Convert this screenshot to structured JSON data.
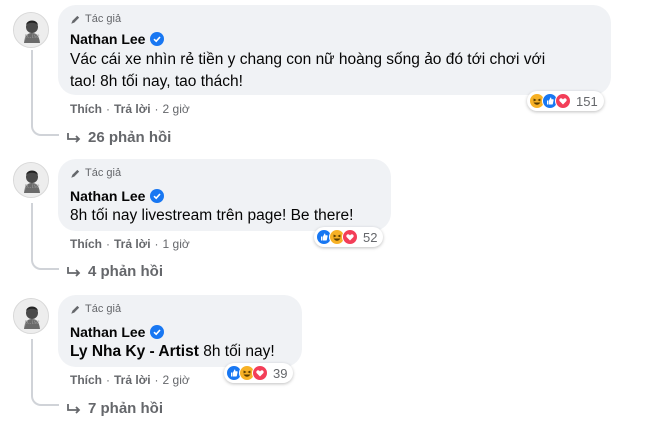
{
  "comments": [
    {
      "author_tag": "Tác giả",
      "name": "Nathan Lee",
      "lines": [
        "Vác cái xe nhìn rẻ tiền y chang con nữ hoàng sống ảo đó tới chơi với",
        "tao! 8h tối nay, tao thách!"
      ],
      "actions": {
        "like": "Thích",
        "reply": "Trả lời",
        "time": "2 giờ"
      },
      "reactions": {
        "icons": [
          "haha",
          "like",
          "love"
        ],
        "count": "151"
      },
      "replies": "26 phản hồi"
    },
    {
      "author_tag": "Tác giả",
      "name": "Nathan Lee",
      "lines": [
        "8h tối nay livestream trên page! Be there!"
      ],
      "actions": {
        "like": "Thích",
        "reply": "Trả lời",
        "time": "1 giờ"
      },
      "reactions": {
        "icons": [
          "like",
          "haha",
          "love"
        ],
        "count": "52"
      },
      "replies": "4 phản hồi"
    },
    {
      "author_tag": "Tác giả",
      "name": "Nathan Lee",
      "mention": "Ly Nha Ky - Artist",
      "text": " 8h tối nay!",
      "actions": {
        "like": "Thích",
        "reply": "Trả lời",
        "time": "2 giờ"
      },
      "reactions": {
        "icons": [
          "like",
          "haha",
          "love"
        ],
        "count": "39"
      },
      "replies": "7 phản hồi"
    }
  ],
  "colors": {
    "bubble": "#f0f2f5",
    "secondary_text": "#65676b",
    "verified": "#1877f2",
    "like": "#1877f2",
    "love": "#f33e58",
    "haha": "#f7b125"
  },
  "avatar": {
    "label": "p..ise"
  }
}
